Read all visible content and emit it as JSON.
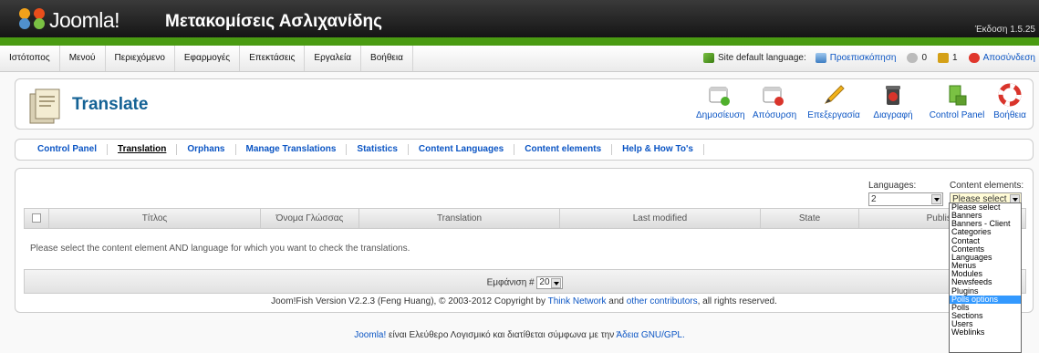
{
  "header": {
    "brand": "Joomla!",
    "site_name": "Μετακομίσεις Ασλιχανίδης",
    "version": "Έκδοση 1.5.25"
  },
  "menu": [
    "Ιστότοπος",
    "Μενού",
    "Περιεχόμενο",
    "Εφαρμογές",
    "Επεκτάσεις",
    "Εργαλεία",
    "Βοήθεια"
  ],
  "status_bar": {
    "site_default_language": "Site default language:",
    "preview": "Προεπισκόπηση",
    "messages": "0",
    "users": "1",
    "logout": "Αποσύνδεση"
  },
  "toolbar": {
    "title": "Translate",
    "buttons": [
      {
        "label": "Δημοσίευση",
        "icon": "publish-icon"
      },
      {
        "label": "Απόσυρση",
        "icon": "unpublish-icon"
      },
      {
        "label": "Επεξεργασία",
        "icon": "edit-icon"
      },
      {
        "label": "Διαγραφή",
        "icon": "delete-icon"
      },
      {
        "label": "Control Panel",
        "icon": "control-panel-icon"
      },
      {
        "label": "Βοήθεια",
        "icon": "help-icon"
      }
    ]
  },
  "subnav": [
    "Control Panel",
    "Translation",
    "Orphans",
    "Manage Translations",
    "Statistics",
    "Content Languages",
    "Content elements",
    "Help & How To's"
  ],
  "filters": {
    "languages_label": "Languages:",
    "languages_value": "2",
    "content_elements_label": "Content elements:",
    "content_elements_value": "Please select"
  },
  "table": {
    "columns": [
      "Τίτλος",
      "Όνομα Γλώσσας",
      "Translation",
      "Last modified",
      "State",
      "Publish"
    ],
    "message": "Please select the content element AND language for which you want to check the translations.",
    "display_label": "Εμφάνιση #",
    "display_value": "20"
  },
  "footer": {
    "copyright_pre": "Joom!Fish Version V2.2.3 (Feng Huang), © 2003-2012 Copyright by",
    "think_network": "Think Network",
    "and": "and",
    "other_contributors": "other contributors",
    "rights": ", all rights reserved."
  },
  "license": {
    "joomla": "Joomla!",
    "text": "είναι Ελεύθερο Λογισμικό και διατίθεται σύμφωνα με την",
    "gpl": "Άδεια GNU/GPL."
  },
  "dropdown": {
    "options": [
      "Please select",
      "Banners",
      "Banners - Client",
      "Categories",
      "Contact",
      "Contents",
      "Languages",
      "Menus",
      "Modules",
      "Newsfeeds",
      "Plugins",
      "Polls options",
      "Polls",
      "Sections",
      "Users",
      "Weblinks"
    ],
    "highlighted": "Polls options"
  },
  "colors": {
    "accent": "#0b55c4",
    "title": "#146295",
    "header_green": "#4a9b12",
    "highlight": "#3399ff"
  }
}
